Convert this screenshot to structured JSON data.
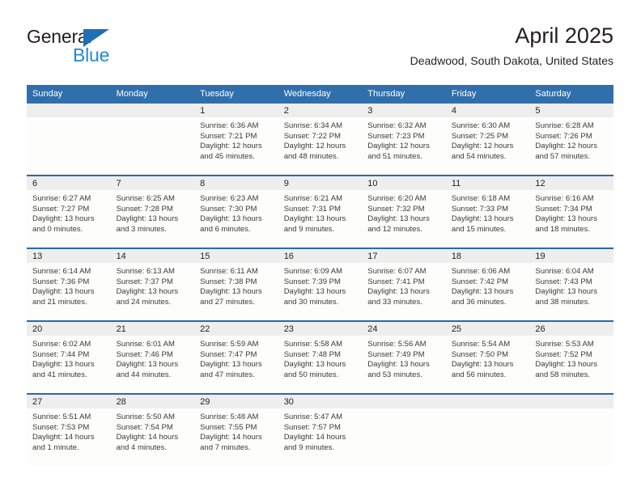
{
  "brand": {
    "name_top": "General",
    "name_bottom": "Blue",
    "triangle_color": "#1f6fb5",
    "top_color": "#231f20",
    "bottom_color": "#1f88d9"
  },
  "header": {
    "title": "April 2025",
    "subtitle": "Deadwood, South Dakota, United States"
  },
  "colors": {
    "header_bar": "#316fac",
    "row_rule": "#2a6aa8",
    "daynum_band": "#eeeeee",
    "cell_bg": "#fdfdfc",
    "text": "#231f20"
  },
  "weekday_headers": [
    "Sunday",
    "Monday",
    "Tuesday",
    "Wednesday",
    "Thursday",
    "Friday",
    "Saturday"
  ],
  "weeks": [
    [
      {
        "day": "",
        "empty": true,
        "sunrise": "",
        "sunset": "",
        "daylight_a": "",
        "daylight_b": ""
      },
      {
        "day": "",
        "empty": true,
        "sunrise": "",
        "sunset": "",
        "daylight_a": "",
        "daylight_b": ""
      },
      {
        "day": "1",
        "empty": false,
        "sunrise": "Sunrise: 6:36 AM",
        "sunset": "Sunset: 7:21 PM",
        "daylight_a": "Daylight: 12 hours",
        "daylight_b": "and 45 minutes."
      },
      {
        "day": "2",
        "empty": false,
        "sunrise": "Sunrise: 6:34 AM",
        "sunset": "Sunset: 7:22 PM",
        "daylight_a": "Daylight: 12 hours",
        "daylight_b": "and 48 minutes."
      },
      {
        "day": "3",
        "empty": false,
        "sunrise": "Sunrise: 6:32 AM",
        "sunset": "Sunset: 7:23 PM",
        "daylight_a": "Daylight: 12 hours",
        "daylight_b": "and 51 minutes."
      },
      {
        "day": "4",
        "empty": false,
        "sunrise": "Sunrise: 6:30 AM",
        "sunset": "Sunset: 7:25 PM",
        "daylight_a": "Daylight: 12 hours",
        "daylight_b": "and 54 minutes."
      },
      {
        "day": "5",
        "empty": false,
        "sunrise": "Sunrise: 6:28 AM",
        "sunset": "Sunset: 7:26 PM",
        "daylight_a": "Daylight: 12 hours",
        "daylight_b": "and 57 minutes."
      }
    ],
    [
      {
        "day": "6",
        "empty": false,
        "sunrise": "Sunrise: 6:27 AM",
        "sunset": "Sunset: 7:27 PM",
        "daylight_a": "Daylight: 13 hours",
        "daylight_b": "and 0 minutes."
      },
      {
        "day": "7",
        "empty": false,
        "sunrise": "Sunrise: 6:25 AM",
        "sunset": "Sunset: 7:28 PM",
        "daylight_a": "Daylight: 13 hours",
        "daylight_b": "and 3 minutes."
      },
      {
        "day": "8",
        "empty": false,
        "sunrise": "Sunrise: 6:23 AM",
        "sunset": "Sunset: 7:30 PM",
        "daylight_a": "Daylight: 13 hours",
        "daylight_b": "and 6 minutes."
      },
      {
        "day": "9",
        "empty": false,
        "sunrise": "Sunrise: 6:21 AM",
        "sunset": "Sunset: 7:31 PM",
        "daylight_a": "Daylight: 13 hours",
        "daylight_b": "and 9 minutes."
      },
      {
        "day": "10",
        "empty": false,
        "sunrise": "Sunrise: 6:20 AM",
        "sunset": "Sunset: 7:32 PM",
        "daylight_a": "Daylight: 13 hours",
        "daylight_b": "and 12 minutes."
      },
      {
        "day": "11",
        "empty": false,
        "sunrise": "Sunrise: 6:18 AM",
        "sunset": "Sunset: 7:33 PM",
        "daylight_a": "Daylight: 13 hours",
        "daylight_b": "and 15 minutes."
      },
      {
        "day": "12",
        "empty": false,
        "sunrise": "Sunrise: 6:16 AM",
        "sunset": "Sunset: 7:34 PM",
        "daylight_a": "Daylight: 13 hours",
        "daylight_b": "and 18 minutes."
      }
    ],
    [
      {
        "day": "13",
        "empty": false,
        "sunrise": "Sunrise: 6:14 AM",
        "sunset": "Sunset: 7:36 PM",
        "daylight_a": "Daylight: 13 hours",
        "daylight_b": "and 21 minutes."
      },
      {
        "day": "14",
        "empty": false,
        "sunrise": "Sunrise: 6:13 AM",
        "sunset": "Sunset: 7:37 PM",
        "daylight_a": "Daylight: 13 hours",
        "daylight_b": "and 24 minutes."
      },
      {
        "day": "15",
        "empty": false,
        "sunrise": "Sunrise: 6:11 AM",
        "sunset": "Sunset: 7:38 PM",
        "daylight_a": "Daylight: 13 hours",
        "daylight_b": "and 27 minutes."
      },
      {
        "day": "16",
        "empty": false,
        "sunrise": "Sunrise: 6:09 AM",
        "sunset": "Sunset: 7:39 PM",
        "daylight_a": "Daylight: 13 hours",
        "daylight_b": "and 30 minutes."
      },
      {
        "day": "17",
        "empty": false,
        "sunrise": "Sunrise: 6:07 AM",
        "sunset": "Sunset: 7:41 PM",
        "daylight_a": "Daylight: 13 hours",
        "daylight_b": "and 33 minutes."
      },
      {
        "day": "18",
        "empty": false,
        "sunrise": "Sunrise: 6:06 AM",
        "sunset": "Sunset: 7:42 PM",
        "daylight_a": "Daylight: 13 hours",
        "daylight_b": "and 36 minutes."
      },
      {
        "day": "19",
        "empty": false,
        "sunrise": "Sunrise: 6:04 AM",
        "sunset": "Sunset: 7:43 PM",
        "daylight_a": "Daylight: 13 hours",
        "daylight_b": "and 38 minutes."
      }
    ],
    [
      {
        "day": "20",
        "empty": false,
        "sunrise": "Sunrise: 6:02 AM",
        "sunset": "Sunset: 7:44 PM",
        "daylight_a": "Daylight: 13 hours",
        "daylight_b": "and 41 minutes."
      },
      {
        "day": "21",
        "empty": false,
        "sunrise": "Sunrise: 6:01 AM",
        "sunset": "Sunset: 7:46 PM",
        "daylight_a": "Daylight: 13 hours",
        "daylight_b": "and 44 minutes."
      },
      {
        "day": "22",
        "empty": false,
        "sunrise": "Sunrise: 5:59 AM",
        "sunset": "Sunset: 7:47 PM",
        "daylight_a": "Daylight: 13 hours",
        "daylight_b": "and 47 minutes."
      },
      {
        "day": "23",
        "empty": false,
        "sunrise": "Sunrise: 5:58 AM",
        "sunset": "Sunset: 7:48 PM",
        "daylight_a": "Daylight: 13 hours",
        "daylight_b": "and 50 minutes."
      },
      {
        "day": "24",
        "empty": false,
        "sunrise": "Sunrise: 5:56 AM",
        "sunset": "Sunset: 7:49 PM",
        "daylight_a": "Daylight: 13 hours",
        "daylight_b": "and 53 minutes."
      },
      {
        "day": "25",
        "empty": false,
        "sunrise": "Sunrise: 5:54 AM",
        "sunset": "Sunset: 7:50 PM",
        "daylight_a": "Daylight: 13 hours",
        "daylight_b": "and 56 minutes."
      },
      {
        "day": "26",
        "empty": false,
        "sunrise": "Sunrise: 5:53 AM",
        "sunset": "Sunset: 7:52 PM",
        "daylight_a": "Daylight: 13 hours",
        "daylight_b": "and 58 minutes."
      }
    ],
    [
      {
        "day": "27",
        "empty": false,
        "sunrise": "Sunrise: 5:51 AM",
        "sunset": "Sunset: 7:53 PM",
        "daylight_a": "Daylight: 14 hours",
        "daylight_b": "and 1 minute."
      },
      {
        "day": "28",
        "empty": false,
        "sunrise": "Sunrise: 5:50 AM",
        "sunset": "Sunset: 7:54 PM",
        "daylight_a": "Daylight: 14 hours",
        "daylight_b": "and 4 minutes."
      },
      {
        "day": "29",
        "empty": false,
        "sunrise": "Sunrise: 5:48 AM",
        "sunset": "Sunset: 7:55 PM",
        "daylight_a": "Daylight: 14 hours",
        "daylight_b": "and 7 minutes."
      },
      {
        "day": "30",
        "empty": false,
        "sunrise": "Sunrise: 5:47 AM",
        "sunset": "Sunset: 7:57 PM",
        "daylight_a": "Daylight: 14 hours",
        "daylight_b": "and 9 minutes."
      },
      {
        "day": "",
        "empty": true,
        "sunrise": "",
        "sunset": "",
        "daylight_a": "",
        "daylight_b": ""
      },
      {
        "day": "",
        "empty": true,
        "sunrise": "",
        "sunset": "",
        "daylight_a": "",
        "daylight_b": ""
      },
      {
        "day": "",
        "empty": true,
        "sunrise": "",
        "sunset": "",
        "daylight_a": "",
        "daylight_b": ""
      }
    ]
  ]
}
